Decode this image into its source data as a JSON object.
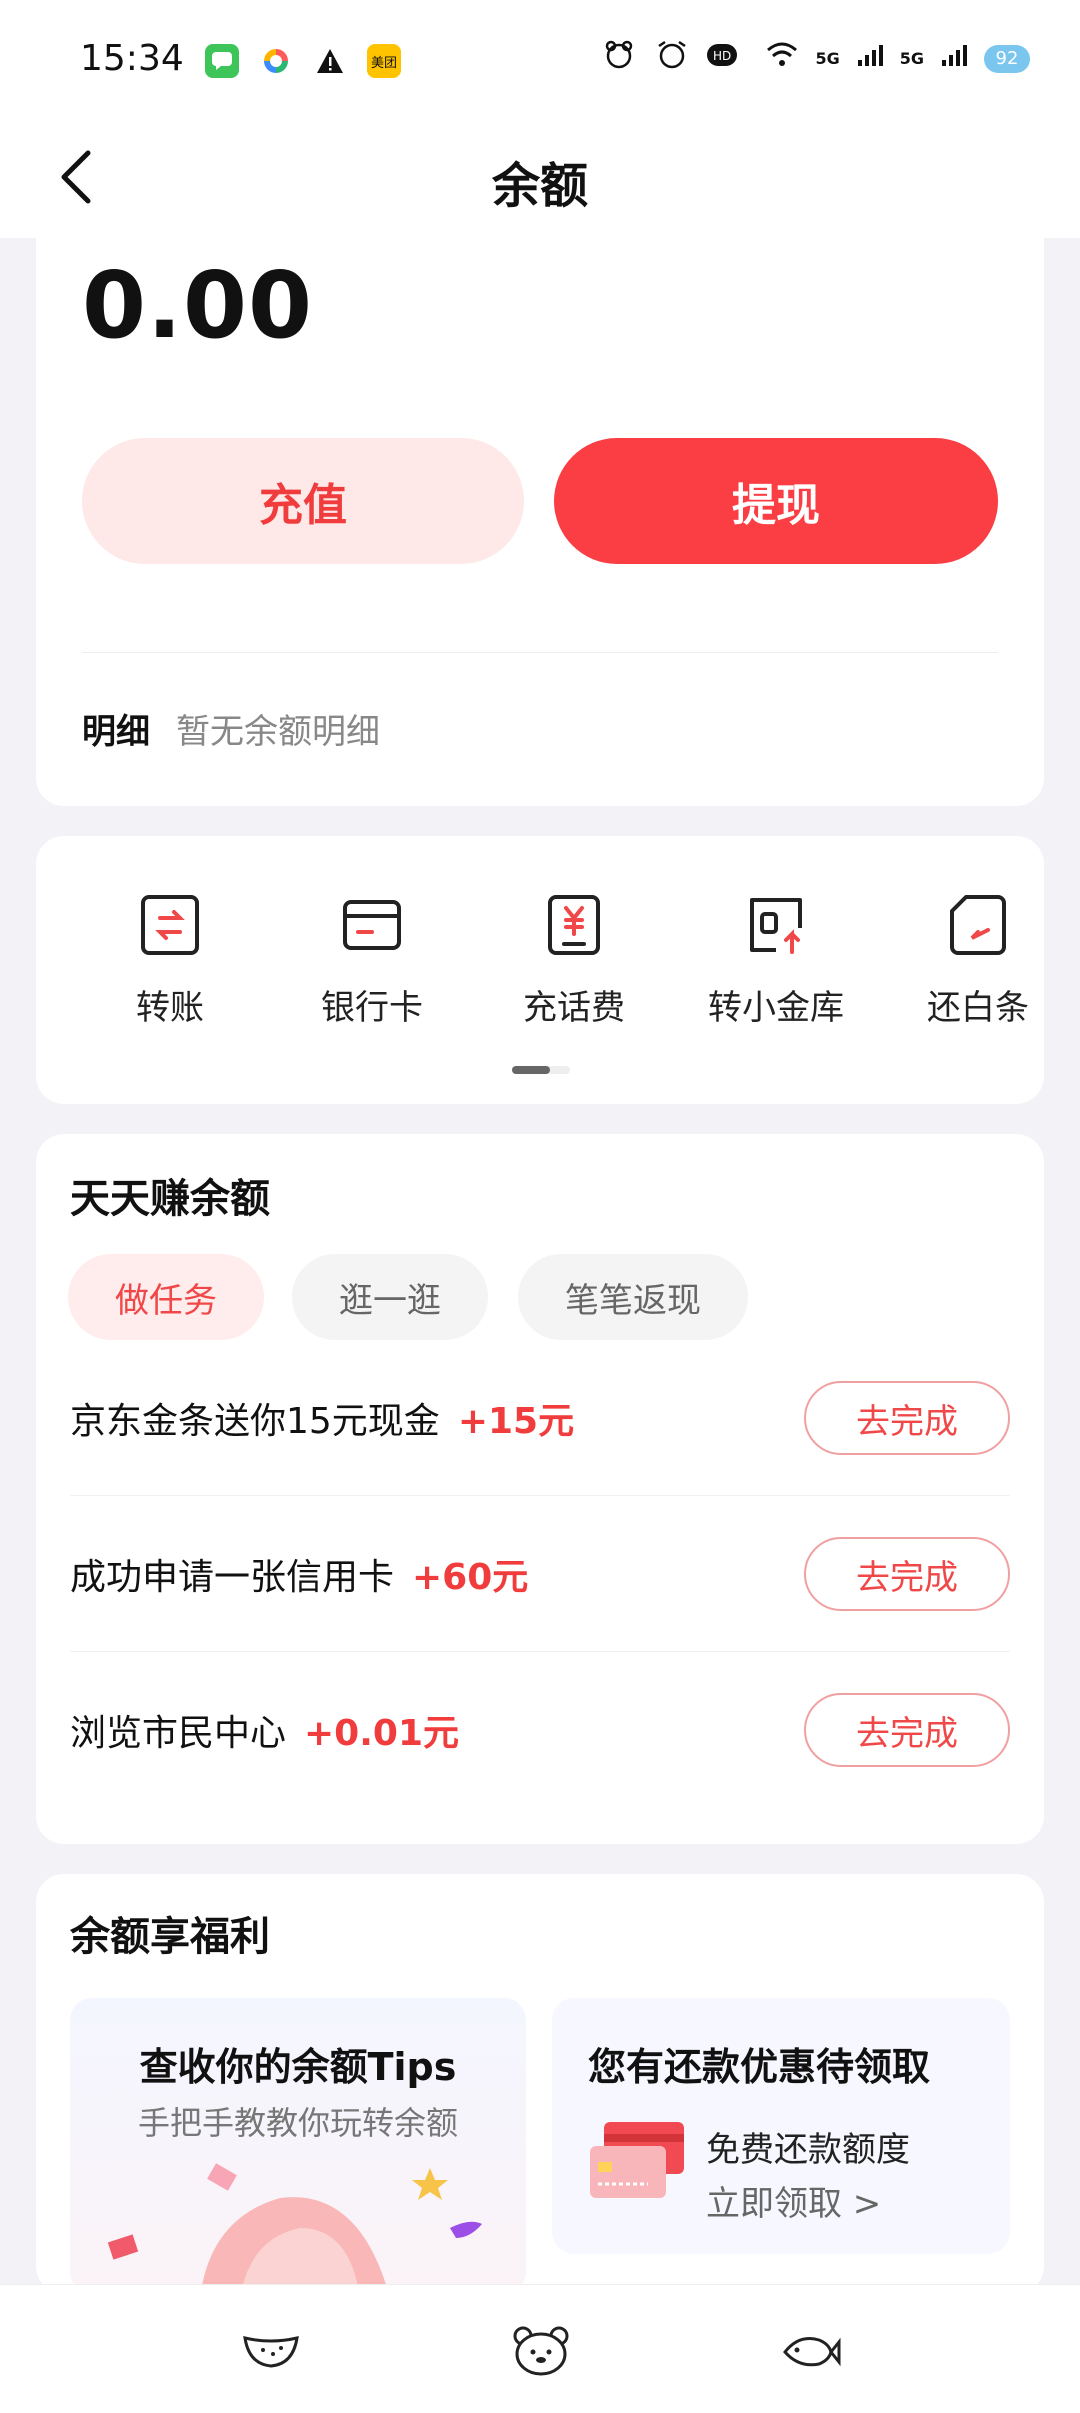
{
  "status_bar": {
    "time": "15:34",
    "left_apps": [
      {
        "icon": "messages-app-icon",
        "color": "#3dc55a"
      },
      {
        "icon": "colorful-app-icon",
        "color": "#7b5cff"
      },
      {
        "icon": "warning-icon",
        "color": "#111111"
      },
      {
        "icon": "meituan-app-icon",
        "color": "#ffc300",
        "label": "美团"
      }
    ],
    "network_label_1": "5G",
    "network_label_2": "5G",
    "battery_level": "92"
  },
  "nav": {
    "title": "余额"
  },
  "balance": {
    "amount": "0.00",
    "recharge_label": "充值",
    "withdraw_label": "提现",
    "detail_label": "明细",
    "detail_empty": "暂无余额明细"
  },
  "quick_actions": [
    {
      "label": "转账",
      "icon": "transfer-icon"
    },
    {
      "label": "银行卡",
      "icon": "bank-card-icon"
    },
    {
      "label": "充话费",
      "icon": "phone-bill-icon"
    },
    {
      "label": "转小金库",
      "icon": "vault-transfer-icon"
    },
    {
      "label": "还白条",
      "icon": "repay-baitiao-icon"
    }
  ],
  "earn": {
    "title": "天天赚余额",
    "tabs": [
      {
        "label": "做任务",
        "active": true
      },
      {
        "label": "逛一逛",
        "active": false
      },
      {
        "label": "笔笔返现",
        "active": false
      }
    ],
    "tasks": [
      {
        "text": "京东金条送你15元现金",
        "reward": "+15元",
        "button": "去完成"
      },
      {
        "text": "成功申请一张信用卡",
        "reward": "+60元",
        "button": "去完成"
      },
      {
        "text": "浏览市民中心",
        "reward": "+0.01元",
        "button": "去完成"
      }
    ]
  },
  "benefits": {
    "title": "余额享福利",
    "left_card": {
      "title": "查收你的余额Tips",
      "subtitle": "手把手教教你玩转余额"
    },
    "right_card": {
      "title": "您有还款优惠待领取",
      "line1": "免费还款额度",
      "line2": "立即领取 >"
    }
  },
  "bottom_bar": [
    "watermelon-icon",
    "bear-face-icon",
    "fish-icon"
  ],
  "colors": {
    "accent": "#fa3e43",
    "accent_light": "#ffe8e8",
    "background": "#f2f2f7"
  }
}
